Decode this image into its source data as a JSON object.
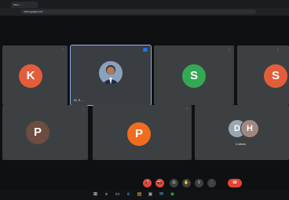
{
  "browser": {
    "tab_title": "Meet - ...",
    "url": "meet.google.com"
  },
  "participants": [
    {
      "id": "k",
      "initial": "K",
      "color": "#e45d3a",
      "name": ""
    },
    {
      "id": "presenter",
      "initial": "",
      "color": "",
      "name": "Dr. S. ..."
    },
    {
      "id": "s1",
      "initial": "S",
      "color": "#34a853",
      "name": ""
    },
    {
      "id": "s2",
      "initial": "S",
      "color": "#e45d3a",
      "name": ""
    },
    {
      "id": "p1",
      "initial": "P",
      "color": "#6d4c41",
      "name": ""
    },
    {
      "id": "p2",
      "initial": "P",
      "color": "#f06c1e",
      "name": ""
    }
  ],
  "others_tile": {
    "initials": [
      "D",
      "H"
    ],
    "colors": [
      "#9aa6b2",
      "#a1887f"
    ],
    "label": "2 others"
  },
  "meeting": {
    "name": ""
  },
  "controls": [
    {
      "name": "mic-off-button",
      "icon": "mic-off-icon",
      "glyph": "🎤",
      "style": "red"
    },
    {
      "name": "camera-off-button",
      "icon": "camera-off-icon",
      "glyph": "📷",
      "style": "red"
    },
    {
      "name": "captions-button",
      "icon": "captions-icon",
      "glyph": "⊡",
      "style": ""
    },
    {
      "name": "raise-hand-button",
      "icon": "hand-icon",
      "glyph": "✋",
      "style": ""
    },
    {
      "name": "present-button",
      "icon": "present-icon",
      "glyph": "⇪",
      "style": ""
    },
    {
      "name": "more-options-button",
      "icon": "more-vert-icon",
      "glyph": "⋮",
      "style": ""
    },
    {
      "name": "leave-call-button",
      "icon": "phone-hangup-icon",
      "glyph": "☎",
      "style": "hang"
    }
  ],
  "taskbar": {
    "apps": [
      "windows-start-icon",
      "search-icon",
      "task-view-icon",
      "edge-icon",
      "file-explorer-icon",
      "store-icon",
      "mail-icon",
      "chrome-icon"
    ],
    "time": "",
    "date": ""
  }
}
